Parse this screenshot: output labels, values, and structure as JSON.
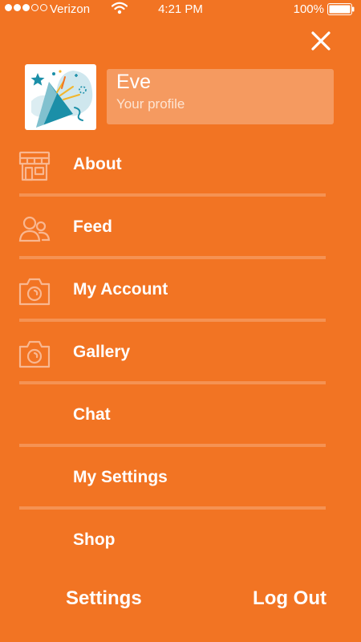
{
  "status_bar": {
    "carrier": "Verizon",
    "time": "4:21 PM",
    "battery": "100%",
    "signal_bars_filled": 3,
    "signal_bars_total": 5
  },
  "header": {
    "close_icon": "close-icon"
  },
  "profile": {
    "name": "Eve",
    "subtitle": "Your profile",
    "avatar_icon": "party-popper-icon"
  },
  "menu": {
    "items": [
      {
        "label": "About",
        "icon": "storefront-icon"
      },
      {
        "label": "Feed",
        "icon": "users-icon"
      },
      {
        "label": "My Account",
        "icon": "camera-icon"
      },
      {
        "label": "Gallery",
        "icon": "camera-icon"
      },
      {
        "label": "Chat",
        "icon": ""
      },
      {
        "label": "My Settings",
        "icon": ""
      },
      {
        "label": "Shop",
        "icon": ""
      }
    ]
  },
  "footer": {
    "settings_label": "Settings",
    "logout_label": "Log Out"
  },
  "colors": {
    "background": "#F27423",
    "text": "#FFFFFF",
    "avatar_accent": "#1B8FA8"
  }
}
